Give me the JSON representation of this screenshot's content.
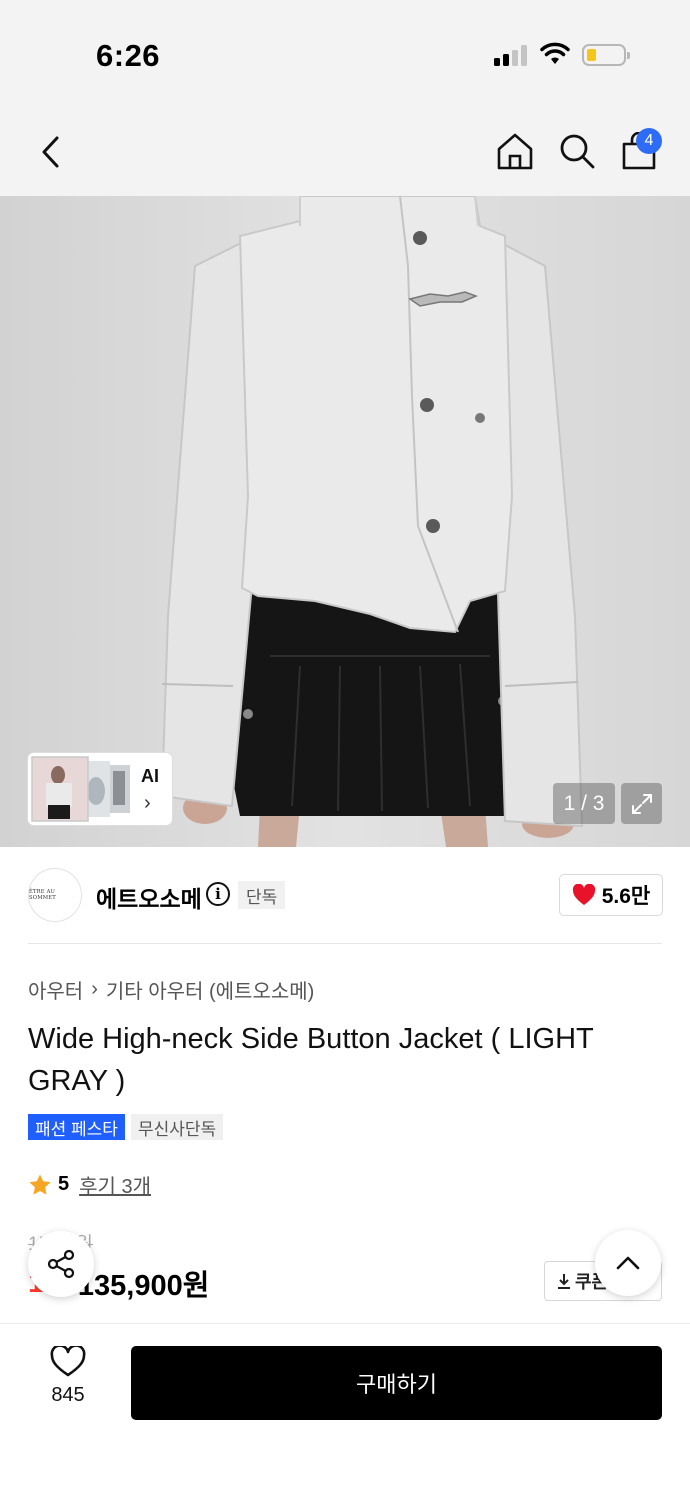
{
  "status_bar": {
    "time": "6:26"
  },
  "nav": {
    "cart_count": "4"
  },
  "gallery": {
    "ai_label": "AI",
    "pager": "1 / 3"
  },
  "brand": {
    "logo_text": "ÊTRE AU SOMMET",
    "name": "에트오소메",
    "exclusive_badge": "단독",
    "likes": "5.6만"
  },
  "product": {
    "breadcrumb": [
      "아우터",
      "기타 아우터 (에트오소메)"
    ],
    "title": "Wide High-neck Side Button Jacket ( LIGHT GRAY )",
    "tags": [
      "패션 페스타",
      "무신사단독"
    ],
    "rating": "5",
    "reviews": "후기 3개",
    "original_price": "15 00원",
    "discount": "1%",
    "price": "135,900원",
    "coupon_label": "쿠폰"
  },
  "bottom": {
    "wish_count": "845",
    "buy_label": "구매하기"
  },
  "colors": {
    "accent_blue": "#1f5eff",
    "sale_red": "#ff3b30",
    "heart_red": "#e8132b",
    "star": "#f5a623"
  }
}
